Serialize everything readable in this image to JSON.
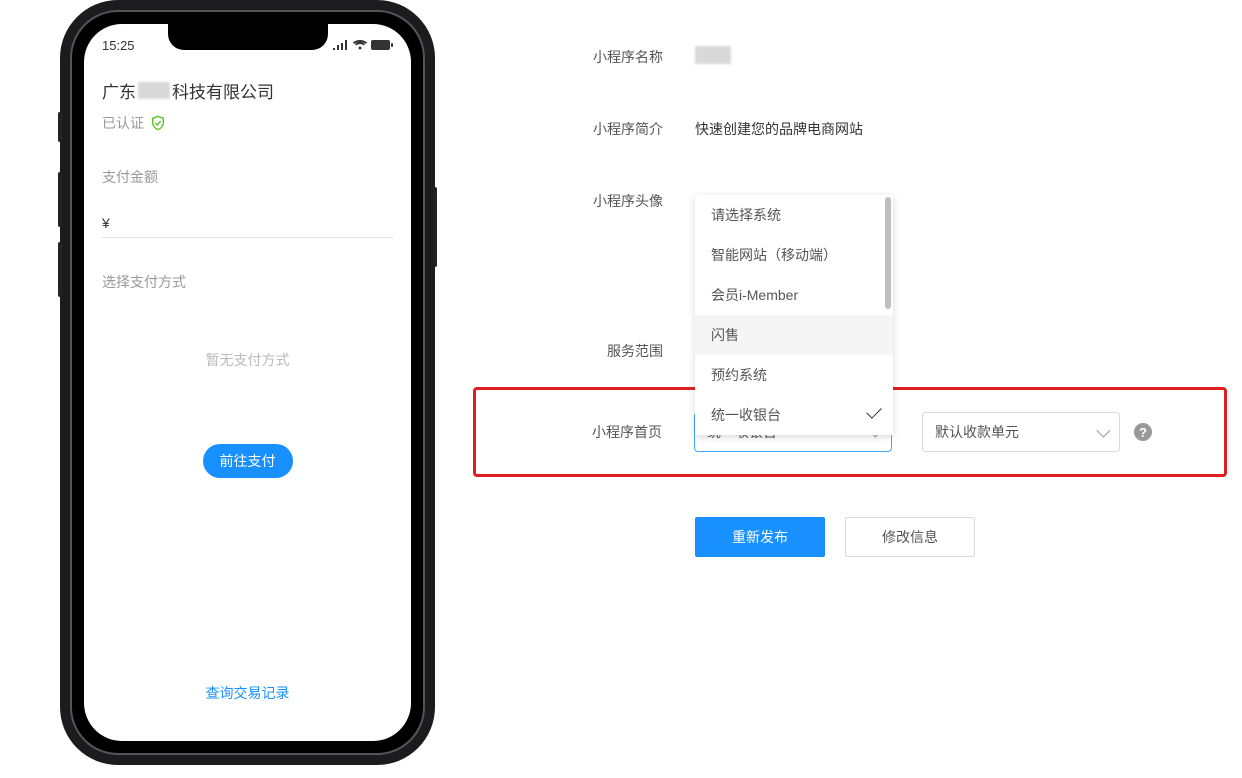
{
  "phone": {
    "time": "15:25",
    "company_prefix": "广东",
    "company_suffix": "科技有限公司",
    "verified_text": "已认证",
    "amount_label": "支付金额",
    "currency_symbol": "¥",
    "pay_method_label": "选择支付方式",
    "no_pay_method_text": "暂无支付方式",
    "pay_button": "前往支付",
    "txn_link": "查询交易记录"
  },
  "form": {
    "labels": {
      "name": "小程序名称",
      "intro": "小程序简介",
      "avatar": "小程序头像",
      "scope": "服务范围",
      "homepage": "小程序首页"
    },
    "intro_value": "快速创建您的品牌电商网站",
    "dropdown_items": [
      "请选择系统",
      "智能网站（移动端）",
      "会员i-Member",
      "闪售",
      "预约系统",
      "统一收银台"
    ],
    "select1_value": "统一收银台",
    "select2_value": "默认收款单元",
    "republish_btn": "重新发布",
    "edit_btn": "修改信息",
    "help_char": "?"
  }
}
